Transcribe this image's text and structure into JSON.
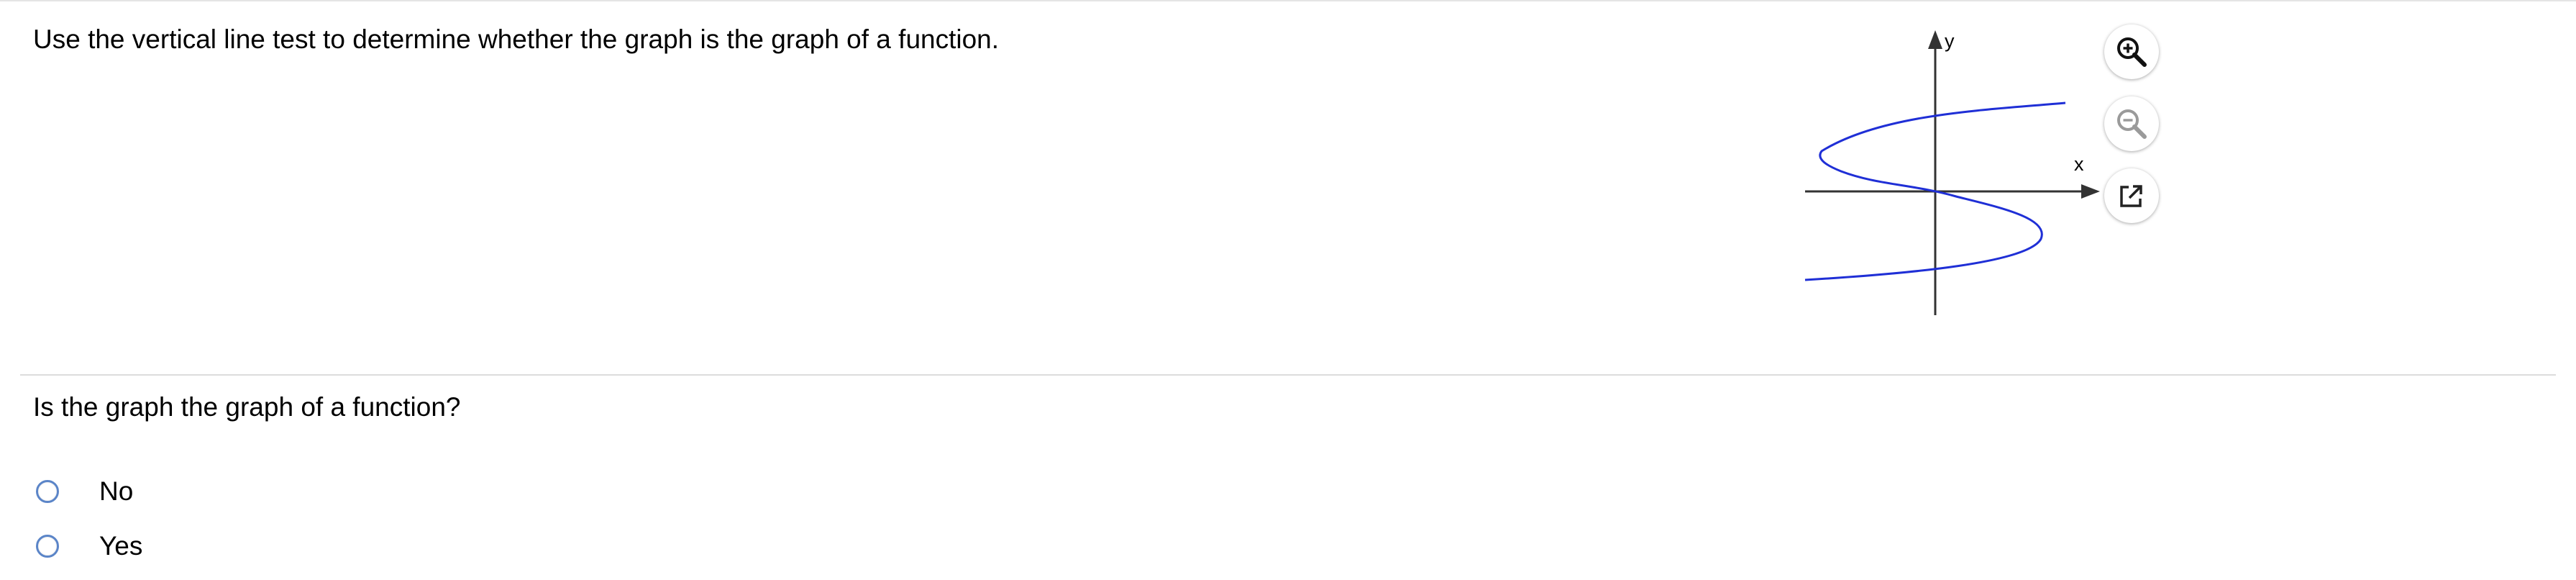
{
  "question_text": {
    "instruction": "Use the vertical line test to determine whether the graph is the graph of a function.",
    "prompt": "Is the graph the graph of a function?"
  },
  "graph": {
    "x_axis_label": "x",
    "y_axis_label": "y",
    "curve_color": "#1f2fd6",
    "axis_color": "#333333"
  },
  "tools": [
    {
      "name": "zoom-in",
      "icon": "zoom-in-icon"
    },
    {
      "name": "zoom-out",
      "icon": "zoom-out-icon",
      "state": "disabled"
    },
    {
      "name": "open-in-new-window",
      "icon": "external-link-icon"
    }
  ],
  "answer_options": {
    "no": {
      "label": "No",
      "selected": false
    },
    "yes": {
      "label": "Yes",
      "selected": false
    }
  }
}
